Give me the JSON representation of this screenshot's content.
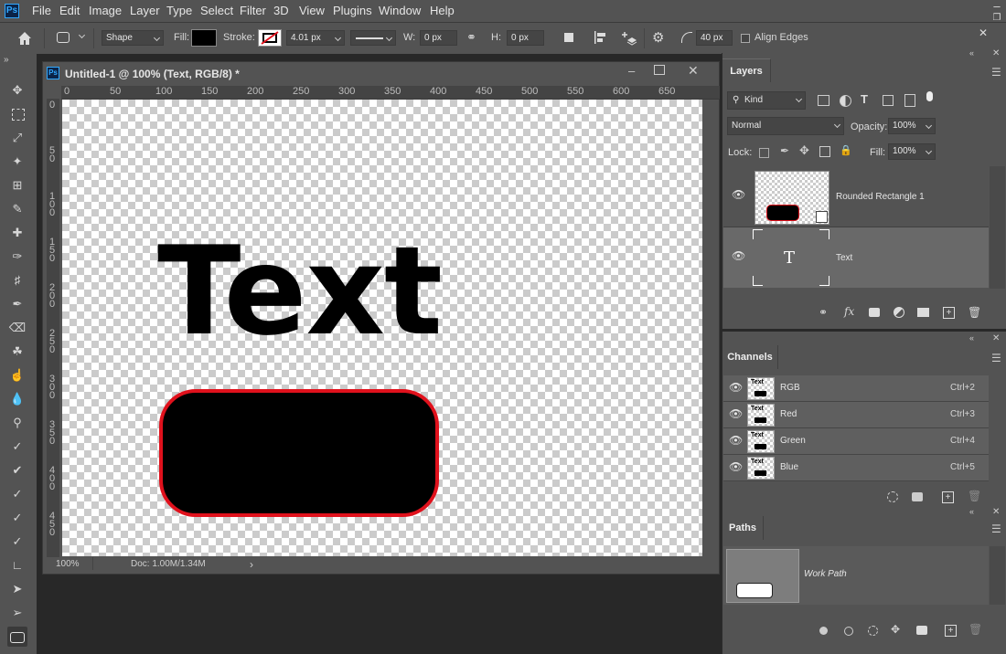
{
  "app": {
    "logo": "Ps"
  },
  "menu": [
    "File",
    "Edit",
    "Image",
    "Layer",
    "Type",
    "Select",
    "Filter",
    "3D",
    "View",
    "Plugins",
    "Window",
    "Help"
  ],
  "options": {
    "mode_value": "Shape",
    "fill_label": "Fill:",
    "stroke_label": "Stroke:",
    "stroke_width": "4.01 px",
    "w_label": "W:",
    "w_value": "0 px",
    "h_label": "H:",
    "h_value": "0 px",
    "radius_value": "40 px",
    "align_edges_label": "Align Edges",
    "fill_color": "#000000"
  },
  "document": {
    "title": "Untitled-1 @ 100% (Text, RGB/8) *",
    "ruler_h": [
      "0",
      "50",
      "100",
      "150",
      "200",
      "250",
      "300",
      "350",
      "400",
      "450",
      "500",
      "550",
      "600",
      "650"
    ],
    "ruler_v": [
      "0",
      "5 0",
      "1 0 0",
      "1 5 0",
      "2 0 0",
      "2 5 0",
      "3 0 0",
      "3 5 0",
      "4 0 0",
      "4 5 0"
    ],
    "canvas_text": "Text",
    "zoom": "100%",
    "doc_size": "Doc: 1.00M/1.34M",
    "shape_fill": "#000000",
    "shape_stroke": "#e0111c"
  },
  "layers_panel": {
    "tab": "Layers",
    "kind_label": "Kind",
    "blend_mode": "Normal",
    "opacity_label": "Opacity:",
    "opacity_value": "100%",
    "lock_label": "Lock:",
    "fill_label": "Fill:",
    "fill_value": "100%",
    "layers": [
      {
        "name": "Rounded Rectangle 1"
      },
      {
        "name": "Text",
        "glyph": "T"
      }
    ]
  },
  "channels_panel": {
    "tab": "Channels",
    "thumb_text": "Text",
    "channels": [
      {
        "name": "RGB",
        "shortcut": "Ctrl+2"
      },
      {
        "name": "Red",
        "shortcut": "Ctrl+3"
      },
      {
        "name": "Green",
        "shortcut": "Ctrl+4"
      },
      {
        "name": "Blue",
        "shortcut": "Ctrl+5"
      }
    ]
  },
  "paths_panel": {
    "tab": "Paths",
    "paths": [
      {
        "name": "Work Path"
      }
    ]
  }
}
